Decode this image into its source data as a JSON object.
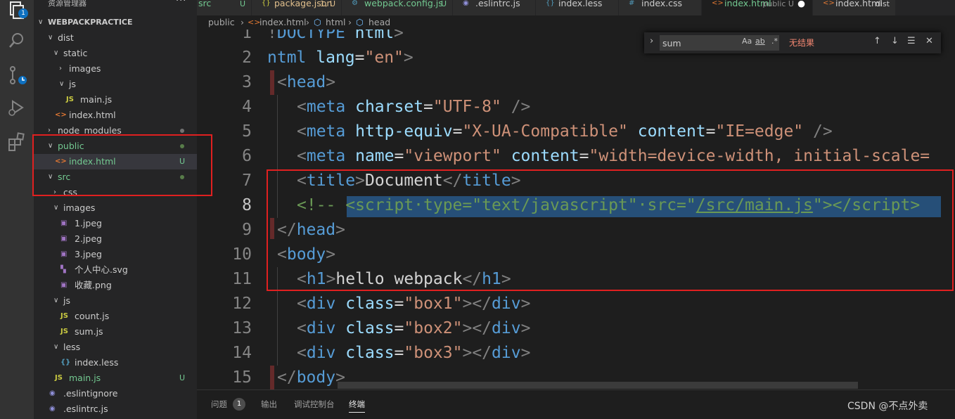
{
  "activity_bar": {
    "badge": "1",
    "icons": [
      "explorer-icon",
      "search-icon",
      "source-control-icon",
      "run-debug-icon",
      "extensions-icon"
    ]
  },
  "sidebar": {
    "title": "资源管理器",
    "more": "···",
    "project": "WEBPACKPRACTICE",
    "tree": [
      {
        "label": "dist",
        "kind": "folder-open",
        "depth": 1
      },
      {
        "label": "static",
        "kind": "folder-open",
        "depth": 2
      },
      {
        "label": "images",
        "kind": "folder-closed",
        "depth": 3
      },
      {
        "label": "js",
        "kind": "folder-open",
        "depth": 3
      },
      {
        "label": "main.js",
        "kind": "js",
        "depth": 4
      },
      {
        "label": "index.html",
        "kind": "html",
        "depth": 2
      },
      {
        "label": "node_modules",
        "kind": "folder-closed",
        "depth": 1
      },
      {
        "label": "public",
        "kind": "folder-open",
        "depth": 1,
        "color": "#73c991"
      },
      {
        "label": "index.html",
        "kind": "html",
        "depth": 2,
        "color": "#73c991",
        "badge": "U",
        "selected": true
      },
      {
        "label": "src",
        "kind": "folder-open",
        "depth": 1,
        "color": "#73c991"
      },
      {
        "label": "css",
        "kind": "folder-closed",
        "depth": 2
      },
      {
        "label": "images",
        "kind": "folder-open",
        "depth": 2
      },
      {
        "label": "1.jpeg",
        "kind": "img",
        "depth": 3
      },
      {
        "label": "2.jpeg",
        "kind": "img",
        "depth": 3
      },
      {
        "label": "3.jpeg",
        "kind": "img",
        "depth": 3
      },
      {
        "label": "个人中心.svg",
        "kind": "svg",
        "depth": 3
      },
      {
        "label": "收藏.png",
        "kind": "img",
        "depth": 3
      },
      {
        "label": "js",
        "kind": "folder-open",
        "depth": 2
      },
      {
        "label": "count.js",
        "kind": "js",
        "depth": 3
      },
      {
        "label": "sum.js",
        "kind": "js",
        "depth": 3
      },
      {
        "label": "less",
        "kind": "folder-open",
        "depth": 2
      },
      {
        "label": "index.less",
        "kind": "less",
        "depth": 3
      },
      {
        "label": "main.js",
        "kind": "js",
        "depth": 2,
        "color": "#73c991",
        "badge": "U"
      },
      {
        "label": ".eslintignore",
        "kind": "eslint",
        "depth": 1
      },
      {
        "label": ".eslintrc.js",
        "kind": "eslint",
        "depth": 1
      }
    ]
  },
  "tabs": [
    {
      "label": "src",
      "sub": "U",
      "color": "#73c991"
    },
    {
      "label": "package.json",
      "sub": "1, U",
      "color": "#e2c08d"
    },
    {
      "label": "webpack.config.js",
      "sub": "U",
      "color": "#73c991"
    },
    {
      "label": ".eslintrc.js",
      "sub": "",
      "color": "#cccccc"
    },
    {
      "label": "index.less",
      "sub": "",
      "color": "#cccccc"
    },
    {
      "label": "index.css",
      "sub": "",
      "color": "#cccccc"
    },
    {
      "label": "index.html",
      "sub": "public U",
      "color": "#73c991",
      "active": true,
      "modified": "●"
    },
    {
      "label": "index.html",
      "sub": "dist",
      "color": "#cccccc"
    }
  ],
  "breadcrumb": [
    "public",
    "index.html",
    "html",
    "head"
  ],
  "find_widget": {
    "value": "sum",
    "match_case": "Aa",
    "match_word": "ab",
    "regex": ".*",
    "result": "无结果",
    "prev": "↑",
    "next": "↓",
    "selection": "☰",
    "close": "✕"
  },
  "editor": {
    "current_line": 8,
    "lines": [
      {
        "n": "1",
        "html": "<span class=\"c-punc\">!</span><span class=\"c-tag\">DOCTYPE</span> <span class=\"c-attr\">html</span><span class=\"c-punc\">&gt;</span>",
        "indent": -1
      },
      {
        "n": "2",
        "html": "<span class=\"c-tag\">ntml</span> <span class=\"c-attr\">lang</span><span class=\"c-text\">=</span><span class=\"c-str\">\"en\"</span><span class=\"c-punc\">&gt;</span>",
        "indent": -1
      },
      {
        "n": "3",
        "html": "<span class=\"c-punc\">&lt;</span><span class=\"c-tag\">head</span><span class=\"c-punc\">&gt;</span>",
        "indent": 0
      },
      {
        "n": "4",
        "html": "<span class=\"c-punc\">&lt;</span><span class=\"c-tag\">meta</span> <span class=\"c-attr\">charset</span><span class=\"c-text\">=</span><span class=\"c-str\">\"UTF-8\"</span> <span class=\"c-punc\">/&gt;</span>",
        "indent": 1
      },
      {
        "n": "5",
        "html": "<span class=\"c-punc\">&lt;</span><span class=\"c-tag\">meta</span> <span class=\"c-attr\">http-equiv</span><span class=\"c-text\">=</span><span class=\"c-str\">\"X-UA-Compatible\"</span> <span class=\"c-attr\">content</span><span class=\"c-text\">=</span><span class=\"c-str\">\"IE=edge\"</span> <span class=\"c-punc\">/&gt;</span>",
        "indent": 1
      },
      {
        "n": "6",
        "html": "<span class=\"c-punc\">&lt;</span><span class=\"c-tag\">meta</span> <span class=\"c-attr\">name</span><span class=\"c-text\">=</span><span class=\"c-str\">\"viewport\"</span> <span class=\"c-attr\">content</span><span class=\"c-text\">=</span><span class=\"c-str\">\"width=device-width, initial-scale=</span>",
        "indent": 1
      },
      {
        "n": "7",
        "html": "<span class=\"c-punc\">&lt;</span><span class=\"c-tag\">title</span><span class=\"c-punc\">&gt;</span><span class=\"c-text\">Document</span><span class=\"c-punc\">&lt;/</span><span class=\"c-tag\">title</span><span class=\"c-punc\">&gt;</span>",
        "indent": 1
      },
      {
        "n": "8",
        "html": "<span class=\"c-com\">&lt;!-- &lt;script·type=\"text/javascript\"·src=\"<u>/src/main.js</u>\"&gt;&lt;/script&gt;</span>",
        "indent": 1
      },
      {
        "n": "9",
        "html": "<span class=\"c-punc\">&lt;/</span><span class=\"c-tag\">head</span><span class=\"c-punc\">&gt;</span>",
        "indent": 0
      },
      {
        "n": "10",
        "html": "<span class=\"c-punc\">&lt;</span><span class=\"c-tag\">body</span><span class=\"c-punc\">&gt;</span>",
        "indent": 0
      },
      {
        "n": "11",
        "html": "<span class=\"c-punc\">&lt;</span><span class=\"c-tag\">h1</span><span class=\"c-punc\">&gt;</span><span class=\"c-text\">hello webpack</span><span class=\"c-punc\">&lt;/</span><span class=\"c-tag\">h1</span><span class=\"c-punc\">&gt;</span>",
        "indent": 1
      },
      {
        "n": "12",
        "html": "<span class=\"c-punc\">&lt;</span><span class=\"c-tag\">div</span> <span class=\"c-attr\">class</span><span class=\"c-text\">=</span><span class=\"c-str\">\"box1\"</span><span class=\"c-punc\">&gt;&lt;/</span><span class=\"c-tag\">div</span><span class=\"c-punc\">&gt;</span>",
        "indent": 1
      },
      {
        "n": "13",
        "html": "<span class=\"c-punc\">&lt;</span><span class=\"c-tag\">div</span> <span class=\"c-attr\">class</span><span class=\"c-text\">=</span><span class=\"c-str\">\"box2\"</span><span class=\"c-punc\">&gt;&lt;/</span><span class=\"c-tag\">div</span><span class=\"c-punc\">&gt;</span>",
        "indent": 1
      },
      {
        "n": "14",
        "html": "<span class=\"c-punc\">&lt;</span><span class=\"c-tag\">div</span> <span class=\"c-attr\">class</span><span class=\"c-text\">=</span><span class=\"c-str\">\"box3\"</span><span class=\"c-punc\">&gt;&lt;/</span><span class=\"c-tag\">div</span><span class=\"c-punc\">&gt;</span>",
        "indent": 1
      },
      {
        "n": "15",
        "html": "<span class=\"c-punc\">&lt;/</span><span class=\"c-tag\">body</span><span class=\"c-punc\">&gt;</span>",
        "indent": 0
      }
    ]
  },
  "panel": {
    "tabs": [
      "问题",
      "输出",
      "调试控制台",
      "终端"
    ],
    "problems_count": "1",
    "active": "终端"
  },
  "watermark": "CSDN @不点外卖"
}
